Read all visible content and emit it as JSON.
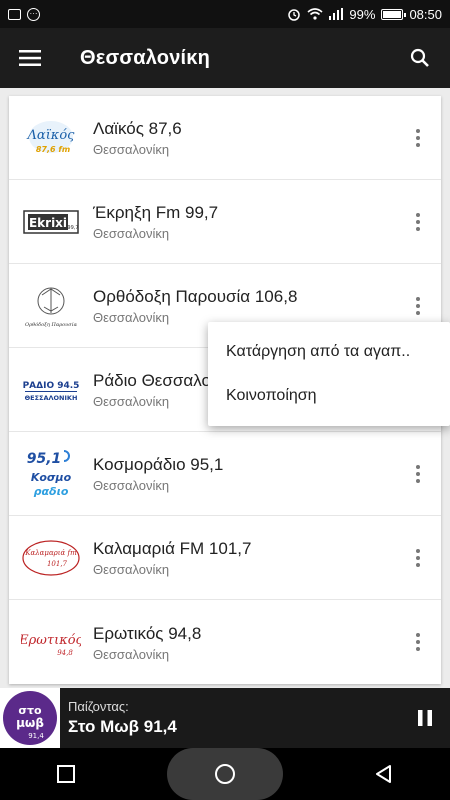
{
  "status_bar": {
    "battery": "99%",
    "time": "08:50"
  },
  "app_bar": {
    "title": "Θεσσαλονίκη"
  },
  "stations": [
    {
      "name": "Λαϊκός 87,6",
      "city": "Θεσσαλονίκη",
      "logo_text": "Λαϊκός",
      "logo_sub": "87,6 fm"
    },
    {
      "name": "Έκρηξη Fm 99,7",
      "city": "Θεσσαλονίκη",
      "logo_text": "Ekrixi",
      "logo_sub": "99,7"
    },
    {
      "name": "Ορθόδοξη Παρουσία 106,8",
      "city": "Θεσσαλονίκη",
      "logo_text": "Ορθόδοξη Παρουσία",
      "logo_sub": ""
    },
    {
      "name": "Ράδιο Θεσσαλο",
      "city": "Θεσσαλονίκη",
      "logo_text": "ΡΑΔΙΟ 94.5",
      "logo_sub": "ΘΕΣΣΑΛΟΝΙΚΗ"
    },
    {
      "name": "Κοσμοράδιο 95,1",
      "city": "Θεσσαλονίκη",
      "logo_text": "95,1",
      "logo_sub": "Κοσμο ραδιο"
    },
    {
      "name": "Καλαμαριά FM 101,7",
      "city": "Θεσσαλονίκη",
      "logo_text": "Καλαμαριά fm",
      "logo_sub": "101,7"
    },
    {
      "name": "Ερωτικός 94,8",
      "city": "Θεσσαλονίκη",
      "logo_text": "Ερωτικός",
      "logo_sub": "94,8"
    }
  ],
  "popup_menu": {
    "items": [
      "Κατάργηση από τα αγαπ..",
      "Κοινοποίηση"
    ]
  },
  "player": {
    "label": "Παίζοντας:",
    "title": "Στο Μωβ 91,4",
    "logo_text": "στο μωβ",
    "logo_sub": "91,4"
  },
  "colors": {
    "appbar": "#1d1d1d",
    "player_logo": "#5b2a8a"
  }
}
